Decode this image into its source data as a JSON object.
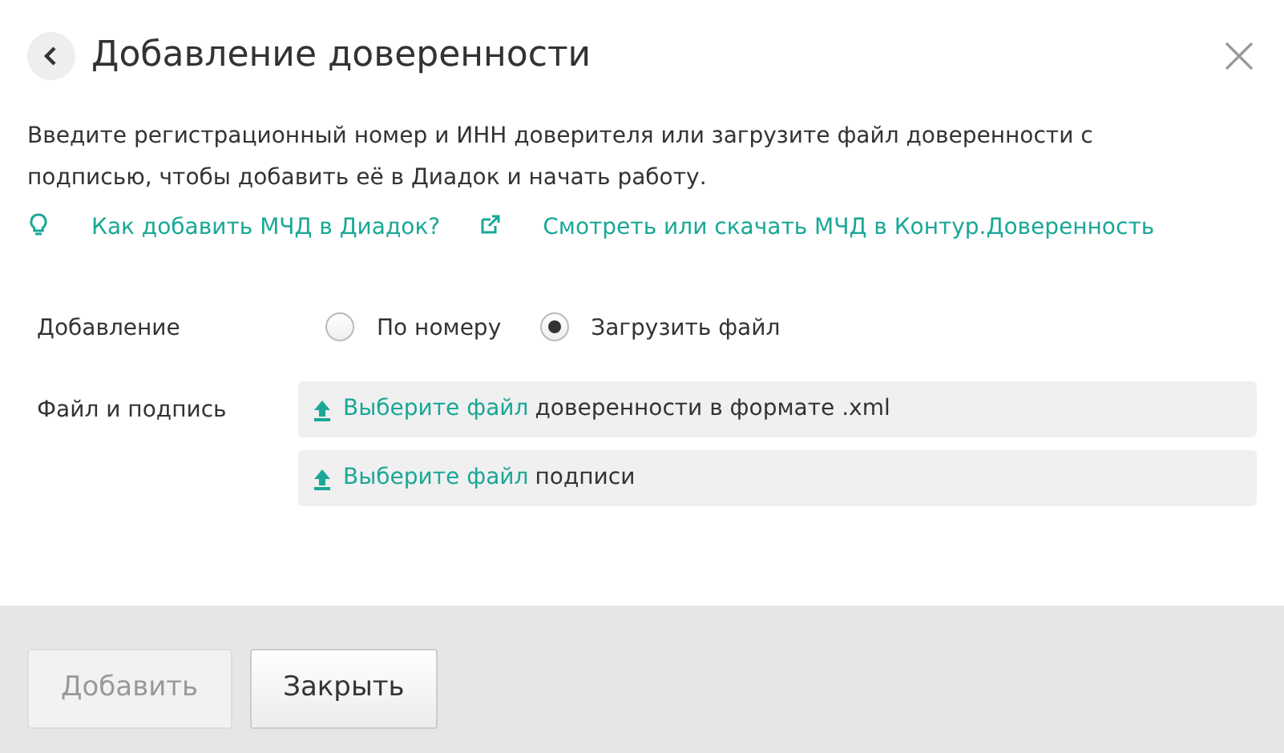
{
  "dialog": {
    "title": "Добавление доверенности",
    "description": "Введите регистрационный номер и ИНН доверителя или загрузите файл доверенности с подписью, чтобы добавить её в Диадок и начать работу."
  },
  "links": [
    {
      "kind": "help",
      "label": "Как добавить МЧД в Диадок?"
    },
    {
      "kind": "external",
      "label": "Смотреть или скачать МЧД в Контур.Доверенность"
    }
  ],
  "add_method": {
    "label": "Добавление",
    "options": [
      {
        "label": "По номеру",
        "selected": false
      },
      {
        "label": "Загрузить файл",
        "selected": true
      }
    ]
  },
  "file_upload": {
    "label": "Файл и подпись",
    "pickers": [
      {
        "link": "Выберите файл",
        "text": "доверенности в формате .xml"
      },
      {
        "link": "Выберите файл",
        "text": "подписи"
      }
    ]
  },
  "buttons": [
    {
      "label": "Добавить",
      "disabled": true
    },
    {
      "label": "Закрыть",
      "disabled": false
    }
  ]
}
